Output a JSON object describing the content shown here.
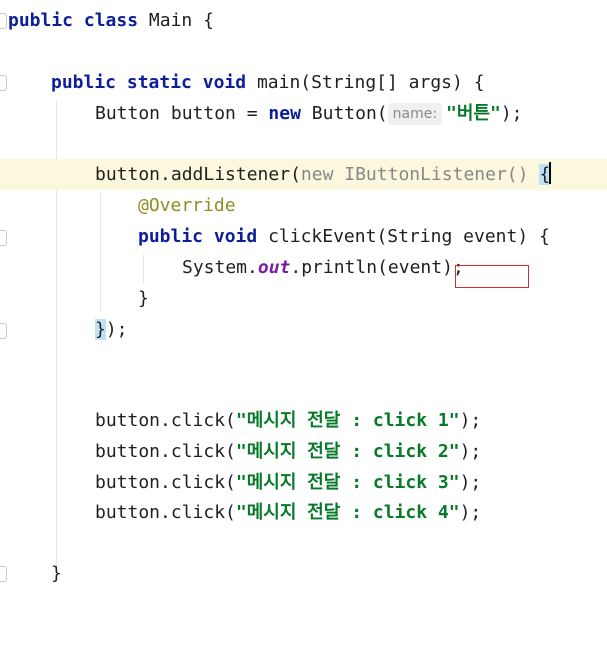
{
  "code": {
    "class_decl": {
      "kw1": "public",
      "kw2": "class",
      "name": "Main",
      "brace": "{"
    },
    "main_decl": {
      "kw1": "public",
      "kw2": "static",
      "kw3": "void",
      "name": "main(String[] args)",
      "brace": "{"
    },
    "button_decl": {
      "type": "Button button =",
      "kw": "new",
      "ctor": "Button(",
      "hint": "name:",
      "arg": "\"버튼\"",
      "end": ");"
    },
    "listener_line": {
      "call": "button.addListener(",
      "anon": "new IButtonListener()",
      "brace": "{"
    },
    "override": "@Override",
    "click_event_decl": {
      "kw1": "public",
      "kw2": "void",
      "sig": "clickEvent(String event)",
      "brace": "{"
    },
    "println_line": {
      "obj": "System.",
      "field": "out",
      "call": ".println(event)",
      "end": ";"
    },
    "method_close": "}",
    "listener_close": {
      "brace": "}",
      "rest": ");"
    },
    "click_calls": [
      {
        "prefix": "button.click(",
        "arg": "\"메시지 전달 : click 1\"",
        "end": ");"
      },
      {
        "prefix": "button.click(",
        "arg": "\"메시지 전달 : click 2\"",
        "end": ");"
      },
      {
        "prefix": "button.click(",
        "arg": "\"메시지 전달 : click 3\"",
        "end": ");"
      },
      {
        "prefix": "button.click(",
        "arg": "\"메시지 전달 : click 4\"",
        "end": ");"
      }
    ],
    "main_close": "}"
  },
  "colors": {
    "keyword": "#0c1e99",
    "string": "#077a2a",
    "annotation": "#8d8d22",
    "static_field": "#7b1fa2",
    "line_highlight": "#fcf8dd",
    "selection_box": "#d32f2f"
  }
}
